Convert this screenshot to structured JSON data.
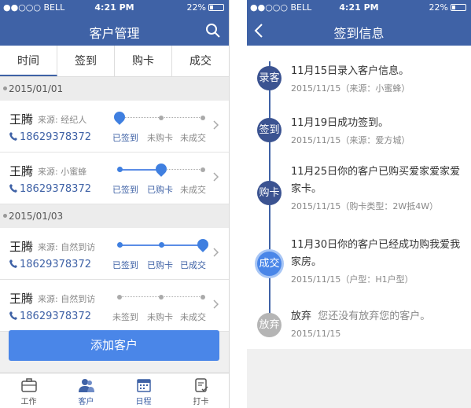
{
  "status": {
    "carrier": "●●○○○ BELL",
    "time": "4:21 PM",
    "battery": "22%"
  },
  "left": {
    "title": "客户管理",
    "tabs": [
      "时间",
      "签到",
      "购卡",
      "成交"
    ],
    "groups": [
      {
        "date": "2015/01/01",
        "customers": [
          {
            "name": "王腾",
            "source": "来源: 经纪人",
            "phone": "18629378372",
            "labels": [
              "已签到",
              "未购卡",
              "未成交"
            ],
            "level": 1
          },
          {
            "name": "王腾",
            "source": "来源: 小蜜蜂",
            "phone": "18629378372",
            "labels": [
              "已签到",
              "已购卡",
              "未成交"
            ],
            "level": 2
          }
        ]
      },
      {
        "date": "2015/01/03",
        "customers": [
          {
            "name": "王腾",
            "source": "来源: 自然到访",
            "phone": "18629378372",
            "labels": [
              "已签到",
              "已购卡",
              "已成交"
            ],
            "level": 3
          },
          {
            "name": "王腾",
            "source": "来源: 自然到访",
            "phone": "18629378372",
            "labels": [
              "未签到",
              "未购卡",
              "未成交"
            ],
            "level": 0
          }
        ]
      }
    ],
    "add_button": "添加客户",
    "tabbar": [
      "工作",
      "客户",
      "日程",
      "打卡"
    ]
  },
  "right": {
    "title": "签到信息",
    "events": [
      {
        "tag": "录客",
        "text": "11月15日录入客户信息。",
        "sub": "2015/11/15（来源：小蜜蜂）"
      },
      {
        "tag": "签到",
        "text": "11月19日成功签到。",
        "sub": "2015/11/15（来源：爱方城）"
      },
      {
        "tag": "购卡",
        "text": "11月25日你的客户已购买爱家爱家爱家卡。",
        "sub": "2015/11/15（购卡类型：2W抵4W）"
      },
      {
        "tag": "成交",
        "text": "11月30日你的客户已经成功购我爱我家房。",
        "sub": "2015/11/15（户型：H1户型）"
      },
      {
        "tag": "放弃",
        "text": "放弃",
        "text_muted": "您还没有放弃您的客户。",
        "sub": "2015/11/15"
      }
    ]
  }
}
